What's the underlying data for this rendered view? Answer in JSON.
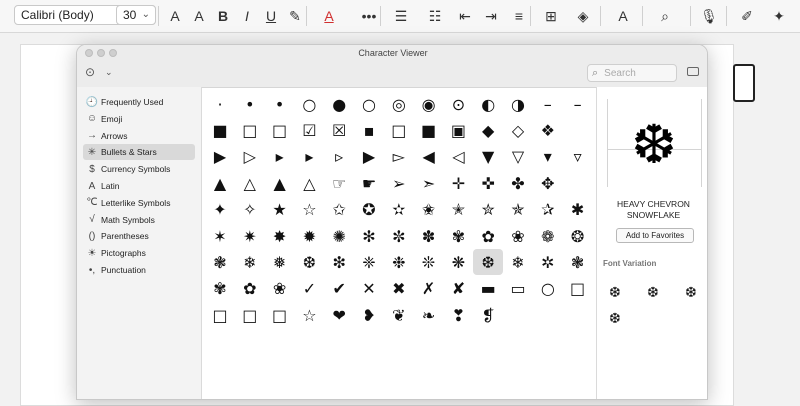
{
  "toolbar": {
    "font_name": "Calibri (Body)",
    "font_size": "30",
    "items": [
      {
        "label": "A",
        "name": "increase-font-size-icon"
      },
      {
        "label": "A",
        "name": "decrease-font-size-icon"
      },
      {
        "label": "B",
        "name": "bold-button"
      },
      {
        "label": "I",
        "name": "italic-button"
      },
      {
        "label": "U",
        "name": "underline-button"
      },
      {
        "label": "✎",
        "name": "highlight-color-icon"
      },
      {
        "label": "A",
        "name": "font-color-icon"
      },
      {
        "label": "•••",
        "name": "more-icon"
      },
      {
        "label": "☰",
        "name": "bullets-icon"
      },
      {
        "label": "☷",
        "name": "numbering-icon"
      },
      {
        "label": "⇤",
        "name": "decrease-indent-icon"
      },
      {
        "label": "⇥",
        "name": "increase-indent-icon"
      },
      {
        "label": "≡",
        "name": "align-icon"
      },
      {
        "label": "⊞",
        "name": "borders-icon"
      },
      {
        "label": "◈",
        "name": "shading-icon"
      },
      {
        "label": "A",
        "name": "styles-icon"
      },
      {
        "label": "⌕",
        "name": "find-icon"
      },
      {
        "label": "🎙",
        "name": "dictate-icon"
      },
      {
        "label": "✐",
        "name": "editor-icon"
      },
      {
        "label": "✦",
        "name": "designer-icon"
      }
    ]
  },
  "viewer": {
    "title": "Character Viewer",
    "search_placeholder": "Search",
    "more_icon": "ellipsis-circle-icon",
    "sidebar": [
      {
        "icon": "🕘",
        "label": "Frequently Used"
      },
      {
        "icon": "☺",
        "label": "Emoji"
      },
      {
        "icon": "→",
        "label": "Arrows"
      },
      {
        "icon": "✳",
        "label": "Bullets & Stars",
        "active": true
      },
      {
        "icon": "$",
        "label": "Currency Symbols"
      },
      {
        "icon": "A",
        "label": "Latin"
      },
      {
        "icon": "℃",
        "label": "Letterlike Symbols"
      },
      {
        "icon": "√",
        "label": "Math Symbols"
      },
      {
        "icon": "()",
        "label": "Parentheses"
      },
      {
        "icon": "☀",
        "label": "Pictographs"
      },
      {
        "icon": "•,",
        "label": "Punctuation"
      }
    ],
    "grid": [
      [
        "·",
        "•",
        "•",
        "○",
        "●",
        "○",
        "◎",
        "◉",
        "⊙",
        "◐",
        "◑",
        "–",
        "–"
      ],
      [
        "■",
        "□",
        "□",
        "☑",
        "☒",
        "▪",
        "□",
        "■",
        "▣",
        "◆",
        "◇",
        "❖"
      ],
      [
        "▶",
        "▷",
        "▸",
        "▸",
        "▹",
        "▶",
        "▻",
        "◀",
        "◁",
        "▼",
        "▽",
        "▾",
        "▿"
      ],
      [
        "▲",
        "△",
        "▲",
        "△",
        "☞",
        "☛",
        "➢",
        "➣",
        "✛",
        "✜",
        "✤",
        "✥"
      ],
      [
        "✦",
        "✧",
        "★",
        "☆",
        "✩",
        "✪",
        "✫",
        "✬",
        "✭",
        "✮",
        "✯",
        "✰",
        "✱"
      ],
      [
        "✶",
        "✷",
        "✸",
        "✹",
        "✺",
        "✻",
        "✼",
        "✽",
        "✾",
        "✿",
        "❀",
        "❁",
        "❂"
      ],
      [
        "❃",
        "❄",
        "❅",
        "❆",
        "❇",
        "❈",
        "❉",
        "❊",
        "❋",
        "❆",
        "❄",
        "✲",
        "❃"
      ],
      [
        "✾",
        "✿",
        "❀",
        "✓",
        "✔",
        "✕",
        "✖",
        "✗",
        "✘",
        "▬",
        "▭",
        "○",
        "□"
      ],
      [
        "□",
        "□",
        "□",
        "☆",
        "❤",
        "❥",
        "❦",
        "❧",
        "❣",
        "❡"
      ]
    ],
    "selected_char": "❆",
    "char_name": [
      "HEAVY CHEVRON",
      "SNOWFLAKE"
    ],
    "favorites_label": "Add to Favorites",
    "font_variation_label": "Font Variation",
    "variations": [
      "❆",
      "❆",
      "❆",
      "❆"
    ]
  }
}
